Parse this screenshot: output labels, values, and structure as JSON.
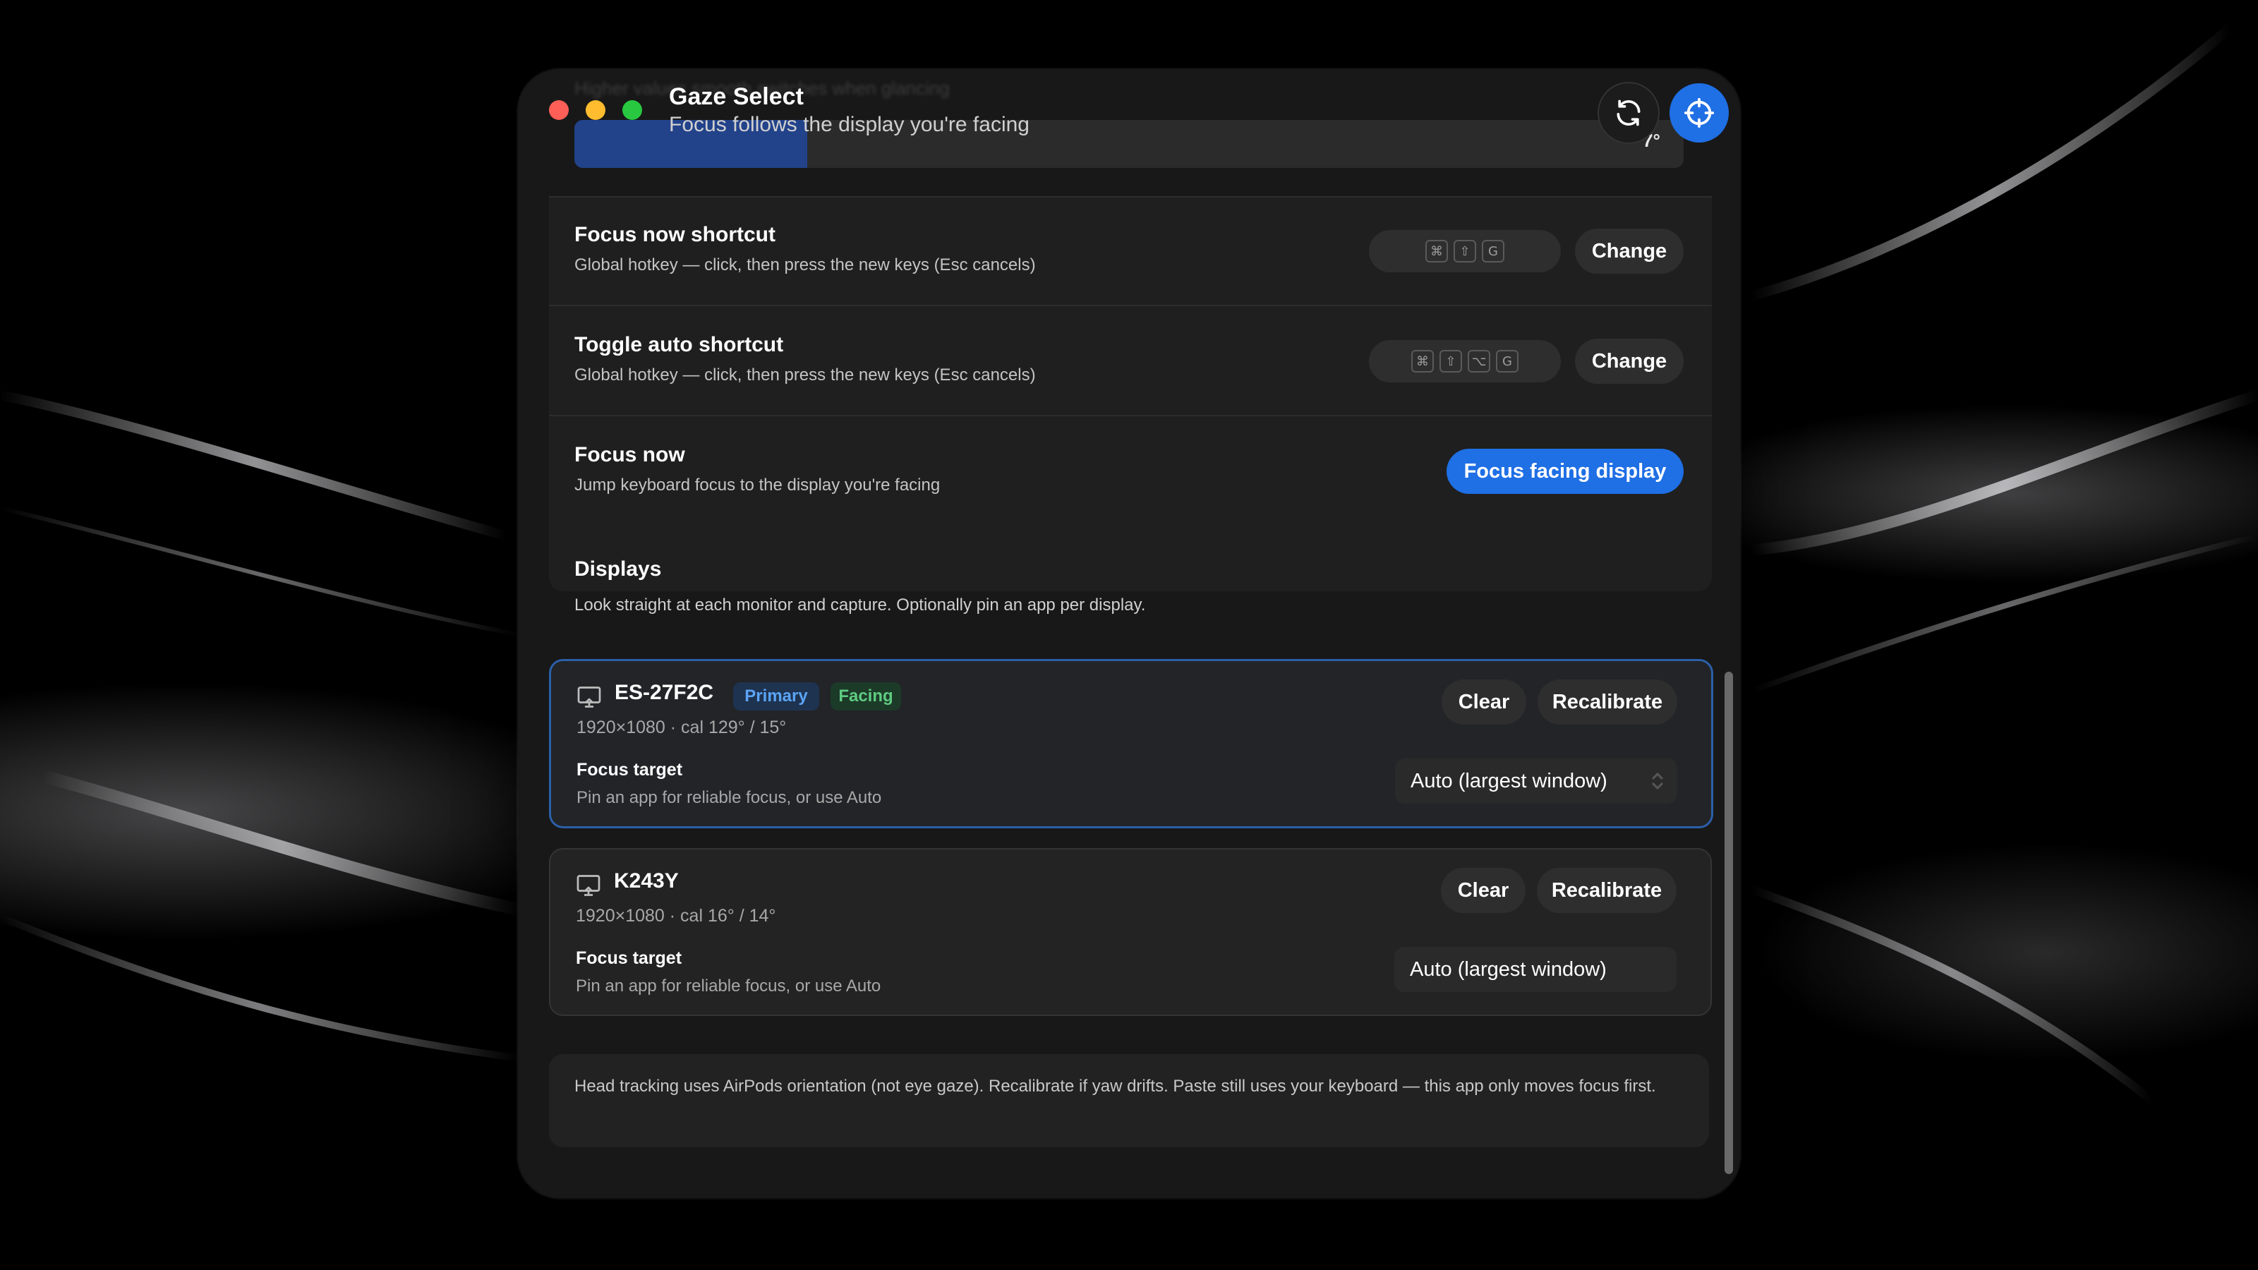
{
  "window": {
    "title": "Gaze Select",
    "subtitle": "Focus follows the display you're facing",
    "ghost_text": "Higher values smooth switches when glancing",
    "slider": {
      "value_label": "7°",
      "fill_fraction": 0.21
    }
  },
  "settings": {
    "focus_now_shortcut": {
      "title": "Focus now shortcut",
      "description": "Global hotkey — click, then press the new keys (Esc cancels)",
      "keys": [
        "⌘",
        "⇧",
        "G"
      ],
      "button": "Change"
    },
    "toggle_auto_shortcut": {
      "title": "Toggle auto shortcut",
      "description": "Global hotkey — click, then press the new keys (Esc cancels)",
      "keys": [
        "⌘",
        "⇧",
        "⌥",
        "G"
      ],
      "button": "Change"
    },
    "focus_now": {
      "title": "Focus now",
      "description": "Jump keyboard focus to the display you're facing",
      "button": "Focus facing display"
    }
  },
  "displays": {
    "title": "Displays",
    "description": "Look straight at each monitor and capture. Optionally pin an app per display.",
    "items": [
      {
        "name": "ES-27F2C",
        "badges": [
          "Primary",
          "Facing"
        ],
        "meta": "1920×1080 · cal 129° / 15°",
        "clear": "Clear",
        "recalibrate": "Recalibrate",
        "focus_target_label": "Focus target",
        "focus_target_desc": "Pin an app for reliable focus, or use Auto",
        "focus_target_value": "Auto (largest window)"
      },
      {
        "name": "K243Y",
        "badges": [],
        "meta": "1920×1080 · cal 16° / 14°",
        "clear": "Clear",
        "recalibrate": "Recalibrate",
        "focus_target_label": "Focus target",
        "focus_target_desc": "Pin an app for reliable focus, or use Auto",
        "focus_target_value": "Auto (largest window)"
      }
    ]
  },
  "footnote": "Head tracking uses AirPods orientation (not eye gaze). Recalibrate if yaw drifts. Paste still uses your keyboard — this app only moves focus first.",
  "colors": {
    "accent": "#1f6fe5",
    "primary_badge": "#5ba4f5",
    "facing_badge": "#5ecb82",
    "window_bg": "#181818"
  },
  "icons": [
    "close-dot",
    "minimize-dot",
    "zoom-dot",
    "refresh-icon",
    "crosshair-icon",
    "monitor-icon",
    "chevron-updown-icon"
  ]
}
